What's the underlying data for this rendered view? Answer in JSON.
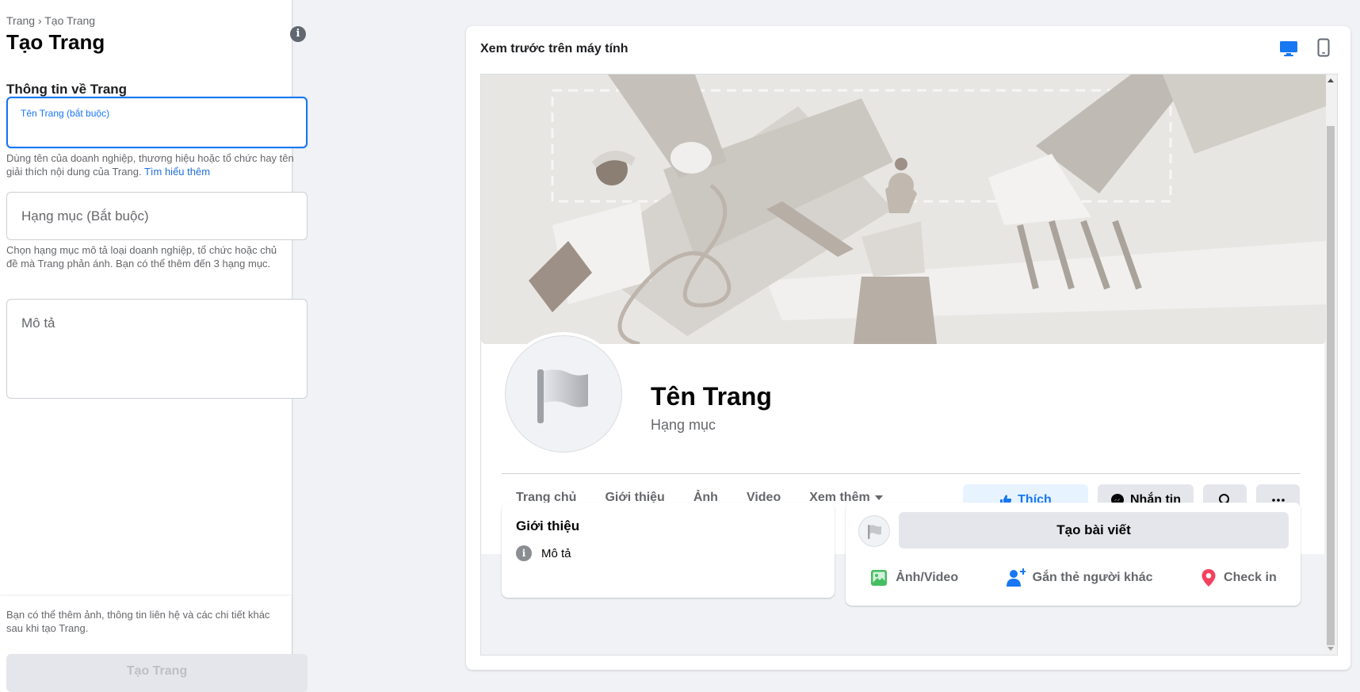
{
  "left_panel": {
    "breadcrumb": "Trang › Tạo Trang",
    "title": "Tạo Trang",
    "section_title": "Thông tin về Trang",
    "name_field": {
      "label": "Tên Trang (bắt buộc)",
      "value": "",
      "help_text": "Dùng tên của doanh nghiệp, thương hiệu hoặc tổ chức hay tên giải thích nội dung của Trang.",
      "help_link": "Tìm hiểu thêm"
    },
    "category_field": {
      "placeholder": "Hạng mục (Bắt buộc)",
      "help_text": "Chọn hạng mục mô tả loại doanh nghiệp, tổ chức hoặc chủ đề mà Trang phản ánh. Bạn có thể thêm đến 3 hạng mục."
    },
    "description_field": {
      "placeholder": "Mô tả"
    },
    "footer_text": "Bạn có thể thêm ảnh, thông tin liên hệ và các chi tiết khác sau khi tạo Trang.",
    "create_button": "Tạo Trang"
  },
  "preview": {
    "title": "Xem trước trên máy tính",
    "page_name": "Tên Trang",
    "page_category": "Hạng mục",
    "nav_tabs": [
      "Trang chủ",
      "Giới thiệu",
      "Ảnh",
      "Video"
    ],
    "nav_more": "Xem thêm",
    "like_button": "Thích",
    "message_button": "Nhắn tin",
    "intro": {
      "title": "Giới thiệu",
      "item": "Mô tả"
    },
    "post": {
      "create": "Tạo bài viết",
      "actions": [
        "Ảnh/Video",
        "Gắn thẻ người khác",
        "Check in"
      ]
    }
  },
  "colors": {
    "accent": "#1877f2",
    "like_bg": "#e7f3ff",
    "photo_green": "#45bd62",
    "tag_blue": "#1877f2",
    "checkin_red": "#f3425f"
  }
}
